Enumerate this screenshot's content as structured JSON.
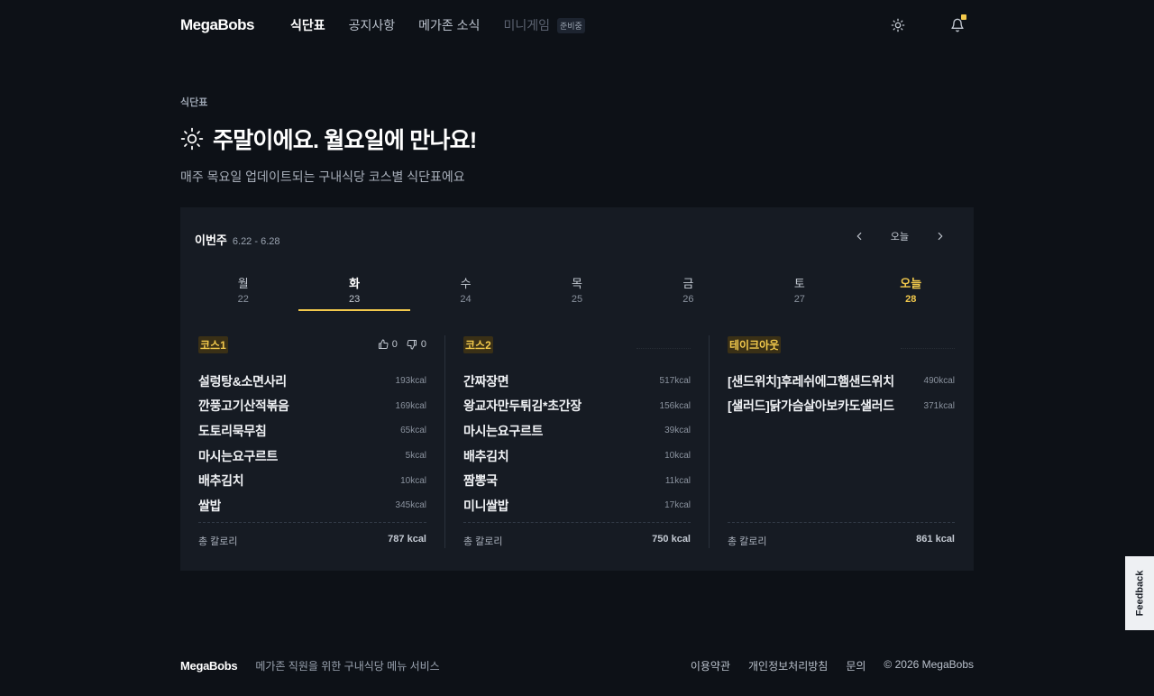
{
  "header": {
    "logo": "MegaBobs",
    "nav": [
      {
        "label": "식단표"
      },
      {
        "label": "공지사항"
      },
      {
        "label": "메가존 소식"
      },
      {
        "label": "미니게임",
        "badge": "준비중"
      }
    ],
    "theme_icon": "sun-icon",
    "notification_icon": "bell-icon"
  },
  "hero": {
    "breadcrumb": "식단표",
    "title": "주말이에요. 월요일에 만나요!",
    "title_icon": "sun-icon",
    "subtitle": "매주 목요일 업데이트되는 구내식당 코스별 식단표에요"
  },
  "week": {
    "label": "이번주",
    "range": "6.22 - 6.28",
    "today_button": "오늘",
    "days": [
      {
        "name": "월",
        "num": "22"
      },
      {
        "name": "화",
        "num": "23"
      },
      {
        "name": "수",
        "num": "24"
      },
      {
        "name": "목",
        "num": "25"
      },
      {
        "name": "금",
        "num": "26"
      },
      {
        "name": "토",
        "num": "27"
      },
      {
        "name": "오늘",
        "num": "28"
      }
    ]
  },
  "courses": [
    {
      "title": "코스1",
      "likes": "0",
      "dislikes": "0",
      "items": [
        {
          "name": "설렁탕&소면사리",
          "kcal": "193kcal"
        },
        {
          "name": "깐풍고기산적볶음",
          "kcal": "169kcal"
        },
        {
          "name": "도토리묵무침",
          "kcal": "65kcal"
        },
        {
          "name": "마시는요구르트",
          "kcal": "5kcal"
        },
        {
          "name": "배추김치",
          "kcal": "10kcal"
        },
        {
          "name": "쌀밥",
          "kcal": "345kcal"
        }
      ],
      "total_label": "총 칼로리",
      "total": "787 kcal"
    },
    {
      "title": "코스2",
      "items": [
        {
          "name": "간짜장면",
          "kcal": "517kcal"
        },
        {
          "name": "왕교자만두튀김*초간장",
          "kcal": "156kcal"
        },
        {
          "name": "마시는요구르트",
          "kcal": "39kcal"
        },
        {
          "name": "배추김치",
          "kcal": "10kcal"
        },
        {
          "name": "짬뽕국",
          "kcal": "11kcal"
        },
        {
          "name": "미니쌀밥",
          "kcal": "17kcal"
        }
      ],
      "total_label": "총 칼로리",
      "total": "750 kcal"
    },
    {
      "title": "테이크아웃",
      "items": [
        {
          "name": "[샌드위치]후레쉬에그햄샌드위치",
          "kcal": "490kcal"
        },
        {
          "name": "[샐러드]닭가슴살아보카도샐러드",
          "kcal": "371kcal"
        }
      ],
      "total_label": "총 칼로리",
      "total": "861 kcal"
    }
  ],
  "footer": {
    "logo": "MegaBobs",
    "description": "메가존 직원을 위한 구내식당 메뉴 서비스",
    "links": [
      "이용약관",
      "개인정보처리방침",
      "문의"
    ],
    "copyright": "© 2026 MegaBobs"
  },
  "feedback_label": "Feedback",
  "colors": {
    "background": "#0d1117",
    "card": "#161b23",
    "accent": "#f2c94c"
  }
}
